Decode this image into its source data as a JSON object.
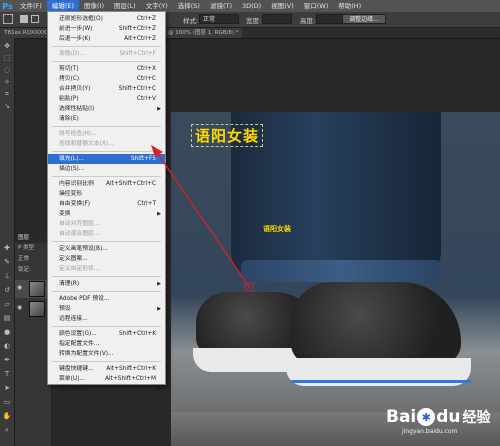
{
  "menubar": {
    "logo": "Ps",
    "items": [
      "文件(F)",
      "编辑(E)",
      "图像(I)",
      "图层(L)",
      "文字(Y)",
      "选择(S)",
      "滤镜(T)",
      "3D(D)",
      "视图(V)",
      "窗口(W)",
      "帮助(H)"
    ]
  },
  "options": {
    "style_label": "样式:",
    "style_value": "正常",
    "width_label": "宽度:",
    "height_label": "高度:",
    "refine_button": "调整边缘..."
  },
  "tabs": {
    "left": "TB1ex.RQXXXXX",
    "right": "@ 100% (图层 1, RGB/8) *"
  },
  "layers_panel": {
    "header": "图层",
    "kind": "P 类型",
    "mode": "正常",
    "lock": "锁定:"
  },
  "canvas": {
    "watermark_big": "语阳女装",
    "watermark_small": "语阳女装"
  },
  "edit_menu": {
    "items": [
      {
        "label": "还原矩形选框(O)",
        "shortcut": "Ctrl+Z"
      },
      {
        "label": "前进一步(W)",
        "shortcut": "Shift+Ctrl+Z"
      },
      {
        "label": "后退一步(K)",
        "shortcut": "Alt+Ctrl+Z"
      },
      {
        "sep": true
      },
      {
        "label": "渐隐(D)...",
        "shortcut": "Shift+Ctrl+F",
        "disabled": true
      },
      {
        "sep": true
      },
      {
        "label": "剪切(T)",
        "shortcut": "Ctrl+X"
      },
      {
        "label": "拷贝(C)",
        "shortcut": "Ctrl+C"
      },
      {
        "label": "合并拷贝(Y)",
        "shortcut": "Shift+Ctrl+C"
      },
      {
        "label": "粘贴(P)",
        "shortcut": "Ctrl+V"
      },
      {
        "label": "选择性粘贴(I)",
        "submenu": true
      },
      {
        "label": "清除(E)"
      },
      {
        "sep": true
      },
      {
        "label": "拼写检查(H)...",
        "disabled": true
      },
      {
        "label": "查找和替换文本(X)...",
        "disabled": true
      },
      {
        "sep": true
      },
      {
        "label": "填充(L)...",
        "shortcut": "Shift+F5",
        "highlighted": true
      },
      {
        "label": "描边(S)..."
      },
      {
        "sep": true
      },
      {
        "label": "内容识别比例",
        "shortcut": "Alt+Shift+Ctrl+C"
      },
      {
        "label": "操控变形"
      },
      {
        "label": "自由变换(F)",
        "shortcut": "Ctrl+T"
      },
      {
        "label": "变换",
        "submenu": true
      },
      {
        "label": "自动对齐图层...",
        "disabled": true
      },
      {
        "label": "自动混合图层...",
        "disabled": true
      },
      {
        "sep": true
      },
      {
        "label": "定义画笔预设(B)..."
      },
      {
        "label": "定义图案..."
      },
      {
        "label": "定义自定形状...",
        "disabled": true
      },
      {
        "sep": true
      },
      {
        "label": "清理(R)",
        "submenu": true
      },
      {
        "sep": true
      },
      {
        "label": "Adobe PDF 预设..."
      },
      {
        "label": "预设",
        "submenu": true
      },
      {
        "label": "远程连接..."
      },
      {
        "sep": true
      },
      {
        "label": "颜色设置(G)...",
        "shortcut": "Shift+Ctrl+K"
      },
      {
        "label": "指定配置文件..."
      },
      {
        "label": "转换为配置文件(V)..."
      },
      {
        "sep": true
      },
      {
        "label": "键盘快捷键...",
        "shortcut": "Alt+Shift+Ctrl+K"
      },
      {
        "label": "菜单(U)...",
        "shortcut": "Alt+Shift+Ctrl+M"
      },
      {
        "label": "首选项(N)",
        "submenu": true
      }
    ]
  },
  "baidu": {
    "brand": "Bai",
    "paw": "du",
    "jingyan": "经验",
    "url": "jingyan.baidu.com"
  },
  "colors": {
    "highlight": "#2e6fd0",
    "watermark": "#ffd900",
    "arrow": "#e02020"
  },
  "icons": [
    "move-icon",
    "marquee-icon",
    "lasso-icon",
    "magic-wand-icon",
    "crop-icon",
    "eyedropper-icon",
    "healing-icon",
    "brush-icon",
    "stamp-icon",
    "history-brush-icon",
    "eraser-icon",
    "gradient-icon",
    "blur-icon",
    "dodge-icon",
    "pen-icon",
    "type-icon",
    "path-select-icon",
    "shape-icon",
    "hand-icon",
    "zoom-icon"
  ]
}
